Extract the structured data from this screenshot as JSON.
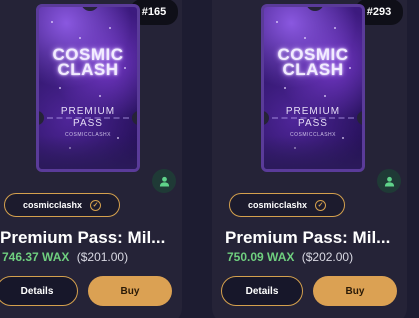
{
  "cards": [
    {
      "id_badge": "#165",
      "ticket": {
        "logo_line1": "COSMIC",
        "logo_line2": "CLASH",
        "title_line1": "PREMIUM",
        "title_line2": "PASS",
        "brand": "COSMICCLASHX"
      },
      "creator": "cosmicclashx",
      "title": "Premium Pass: Mil...",
      "price_wax": "746.37 WAX",
      "price_usd": "($201.00)",
      "details_label": "Details",
      "buy_label": "Buy",
      "user_icon": "user-icon"
    },
    {
      "id_badge": "#293",
      "ticket": {
        "logo_line1": "COSMIC",
        "logo_line2": "CLASH",
        "title_line1": "PREMIUM",
        "title_line2": "PASS",
        "brand": "COSMICCLASHX"
      },
      "creator": "cosmicclashx",
      "title": "Premium Pass: Mil...",
      "price_wax": "750.09 WAX",
      "price_usd": "($202.00)",
      "details_label": "Details",
      "buy_label": "Buy",
      "user_icon": "user-icon"
    }
  ],
  "colors": {
    "accent": "#dba153",
    "price_green": "#6fcf7f",
    "card_bg": "#252337",
    "page_bg": "#1d1c31"
  }
}
